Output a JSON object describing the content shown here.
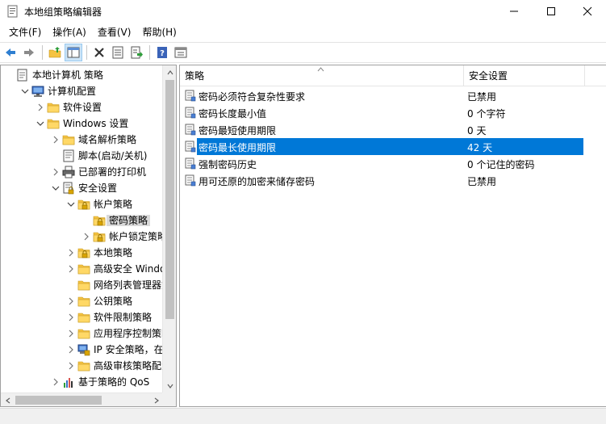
{
  "window": {
    "title": "本地组策略编辑器"
  },
  "menu": {
    "file": "文件(F)",
    "action": "操作(A)",
    "view": "查看(V)",
    "help": "帮助(H)"
  },
  "toolbar": {
    "icons": [
      "back-arrow-icon",
      "forward-arrow-icon",
      "up-folder-icon",
      "show-hide-tree-icon",
      "delete-icon",
      "properties-icon",
      "export-list-icon",
      "help-icon",
      "view-icon"
    ]
  },
  "tree": {
    "items": [
      {
        "label": "本地计算机 策略",
        "icon": "policy-doc-icon",
        "expander": "none"
      },
      {
        "label": "计算机配置",
        "icon": "computer-icon",
        "expander": "expanded"
      },
      {
        "label": "软件设置",
        "icon": "folder-icon",
        "expander": "collapsed"
      },
      {
        "label": "Windows 设置",
        "icon": "folder-icon",
        "expander": "expanded"
      },
      {
        "label": "域名解析策略",
        "icon": "folder-icon",
        "expander": "collapsed"
      },
      {
        "label": "脚本(启动/关机)",
        "icon": "script-icon",
        "expander": "none"
      },
      {
        "label": "已部署的打印机",
        "icon": "printer-icon",
        "expander": "collapsed"
      },
      {
        "label": "安全设置",
        "icon": "security-icon",
        "expander": "expanded"
      },
      {
        "label": "帐户策略",
        "icon": "folder-lock-icon",
        "expander": "expanded"
      },
      {
        "label": "密码策略",
        "icon": "folder-lock-icon",
        "expander": "none"
      },
      {
        "label": "帐户锁定策略",
        "icon": "folder-lock-icon",
        "expander": "collapsed"
      },
      {
        "label": "本地策略",
        "icon": "folder-lock-icon",
        "expander": "collapsed"
      },
      {
        "label": "高级安全 Window",
        "icon": "folder-icon",
        "expander": "collapsed"
      },
      {
        "label": "网络列表管理器策",
        "icon": "folder-icon",
        "expander": "none"
      },
      {
        "label": "公钥策略",
        "icon": "folder-icon",
        "expander": "collapsed"
      },
      {
        "label": "软件限制策略",
        "icon": "folder-icon",
        "expander": "collapsed"
      },
      {
        "label": "应用程序控制策略",
        "icon": "folder-icon",
        "expander": "collapsed"
      },
      {
        "label": "IP 安全策略，在 本",
        "icon": "ip-security-icon",
        "expander": "collapsed"
      },
      {
        "label": "高级审核策略配置",
        "icon": "folder-icon",
        "expander": "collapsed"
      },
      {
        "label": "基于策略的 QoS",
        "icon": "qos-chart-icon",
        "expander": "collapsed"
      }
    ],
    "selected_index": 9
  },
  "list": {
    "columns": [
      "策略",
      "安全设置"
    ],
    "rows": [
      {
        "policy": "密码必须符合复杂性要求",
        "setting": "已禁用"
      },
      {
        "policy": "密码长度最小值",
        "setting": "0 个字符"
      },
      {
        "policy": "密码最短使用期限",
        "setting": "0 天"
      },
      {
        "policy": "密码最长使用期限",
        "setting": "42 天"
      },
      {
        "policy": "强制密码历史",
        "setting": "0 个记住的密码"
      },
      {
        "policy": "用可还原的加密来储存密码",
        "setting": "已禁用"
      }
    ],
    "selected_index": 3
  },
  "colors": {
    "selection": "#0078d7",
    "tree_selection": "#d9d9d9",
    "folder": "#f5c342"
  }
}
